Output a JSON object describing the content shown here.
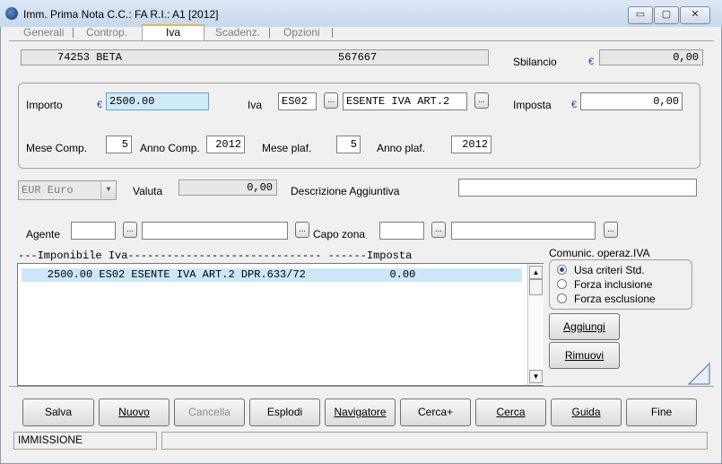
{
  "window": {
    "title": "Imm. Prima Nota C.C.: FA   R.I.: A1  [2012]",
    "minimize": "▭",
    "maximize": "▢",
    "close": "✕"
  },
  "tabs": [
    {
      "label": "Generali"
    },
    {
      "label": "Controp."
    },
    {
      "label": "Iva"
    },
    {
      "label": "Scadenz."
    },
    {
      "label": "Opzioni"
    }
  ],
  "header": {
    "code": "74253 BETA",
    "number": "567667",
    "sbilancio_label": "Sbilancio",
    "sbilancio_value": "0,00"
  },
  "currency_symbol": "€",
  "vat": {
    "importo_label": "Importo",
    "importo_value": "2500.00",
    "iva_label": "Iva",
    "iva_code": "ES02",
    "iva_desc": "ESENTE IVA ART.2",
    "imposta_label": "Imposta",
    "imposta_value": "0,00",
    "mese_comp_label": "Mese Comp.",
    "mese_comp_value": "5",
    "anno_comp_label": "Anno Comp.",
    "anno_comp_value": "2012",
    "mese_plaf_label": "Mese plaf.",
    "mese_plaf_value": "5",
    "anno_plaf_label": "Anno plaf.",
    "anno_plaf_value": "2012"
  },
  "currency": {
    "selected": "EUR Euro",
    "valuta_label": "Valuta",
    "valuta_value": "0,00",
    "descr_label": "Descrizione Aggiuntiva",
    "descr_value": ""
  },
  "agent": {
    "agente_label": "Agente",
    "capo_zona_label": "Capo zona",
    "dots": "..."
  },
  "list": {
    "header": "---Imponibile Iva------------------------------ ------Imposta",
    "rows": [
      {
        "text": "    2500.00 ES02 ESENTE IVA ART.2 DPR.633/72             0.00"
      }
    ]
  },
  "comunic": {
    "label": "Comunic. operaz.IVA",
    "options": [
      {
        "label": "Usa criteri Std.",
        "checked": true
      },
      {
        "label": "Forza inclusione",
        "checked": false
      },
      {
        "label": "Forza esclusione",
        "checked": false
      }
    ],
    "aggiungi": "Aggiungi",
    "rimuovi": "Rimuovi"
  },
  "buttons": [
    {
      "label": "Salva",
      "enabled": true
    },
    {
      "label": "Nuovo",
      "enabled": true
    },
    {
      "label": "Cancella",
      "enabled": false
    },
    {
      "label": "Esplodi",
      "enabled": true
    },
    {
      "label": "Navigatore",
      "enabled": true
    },
    {
      "label": "Cerca+",
      "enabled": true
    },
    {
      "label": "Cerca",
      "enabled": true
    },
    {
      "label": "Guida",
      "enabled": true
    },
    {
      "label": "Fine",
      "enabled": true
    }
  ],
  "status": {
    "mode": "IMMISSIONE",
    "message": ""
  }
}
